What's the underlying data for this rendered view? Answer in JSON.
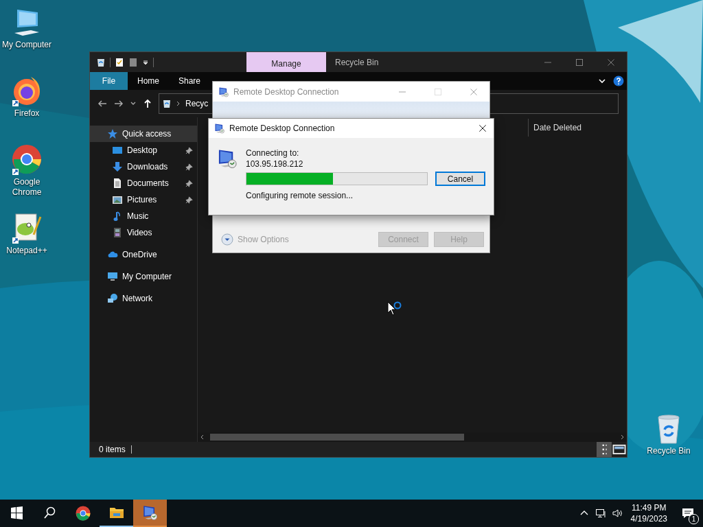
{
  "desktop_icons": [
    {
      "label": "My Computer",
      "kind": "computer"
    },
    {
      "label": "Firefox",
      "kind": "firefox"
    },
    {
      "label": "Google Chrome",
      "kind": "chrome"
    },
    {
      "label": "Notepad++",
      "kind": "notepad"
    }
  ],
  "desktop_right_icon": {
    "label": "Recycle Bin",
    "kind": "recycle"
  },
  "explorer": {
    "title": "Recycle Bin",
    "context_tab": "Manage",
    "ribbon_tabs": [
      {
        "label": "File",
        "kind": "file"
      },
      {
        "label": "Home",
        "kind": "tab"
      },
      {
        "label": "Share",
        "kind": "tab"
      }
    ],
    "address": "Recyc",
    "sidebar": [
      {
        "label": "Quick access",
        "kind": "star",
        "selected": true,
        "children": [
          {
            "label": "Desktop",
            "kind": "desktop",
            "selected": false,
            "pinned": true
          },
          {
            "label": "Downloads",
            "kind": "download",
            "selected": false,
            "pinned": true
          },
          {
            "label": "Documents",
            "kind": "document",
            "selected": false,
            "pinned": true
          },
          {
            "label": "Pictures",
            "kind": "pictures",
            "selected": false,
            "pinned": true
          },
          {
            "label": "Music",
            "kind": "music",
            "selected": false,
            "pinned": false
          },
          {
            "label": "Videos",
            "kind": "videos",
            "selected": false,
            "pinned": false
          }
        ]
      },
      {
        "label": "OneDrive",
        "kind": "cloud",
        "selected": false
      },
      {
        "label": "My Computer",
        "kind": "computer",
        "selected": false
      },
      {
        "label": "Network",
        "kind": "network",
        "selected": false
      }
    ],
    "column_header": "Date Deleted",
    "status": "0 items"
  },
  "back_dialog": {
    "title": "Remote Desktop Connection",
    "options_label": "Show Options",
    "buttons": [
      {
        "label": "Connect",
        "disabled": true
      },
      {
        "label": "Help",
        "disabled": true
      }
    ]
  },
  "progress_dialog": {
    "title": "Remote Desktop Connection",
    "connecting_label": "Connecting to:",
    "address": "103.95.198.212",
    "level": 0.48,
    "status": "Configuring remote session...",
    "button": "Cancel"
  },
  "taskbar": {
    "apps": [
      {
        "kind": "chrome",
        "running": false,
        "active": false
      },
      {
        "kind": "explorer",
        "running": true,
        "active": false
      },
      {
        "kind": "rdc",
        "running": true,
        "active": true
      }
    ],
    "time": "11:49 PM",
    "date": "4/19/2023",
    "notification_count": "1"
  }
}
